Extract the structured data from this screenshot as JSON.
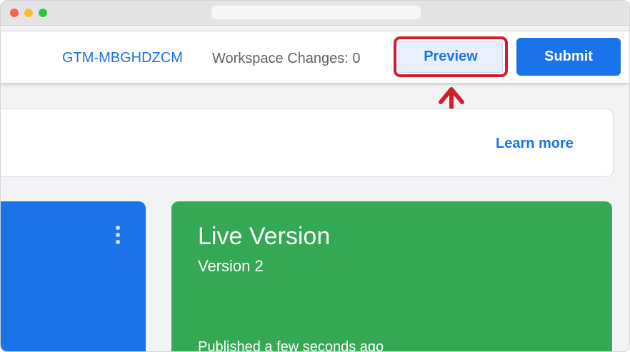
{
  "header": {
    "container_id": "GTM-MBGHDZCM",
    "workspace_changes": "Workspace Changes: 0",
    "preview_label": "Preview",
    "submit_label": "Submit"
  },
  "info_card": {
    "learn_more": "Learn more"
  },
  "live_card": {
    "title": "Live Version",
    "version": "Version 2",
    "published": "Published a few seconds ago"
  },
  "colors": {
    "accent": "#1a73e8",
    "live_green": "#34a853",
    "highlight_red": "#d01f2b"
  },
  "icons": [
    "more-vert-icon",
    "up-arrow-annotation"
  ]
}
